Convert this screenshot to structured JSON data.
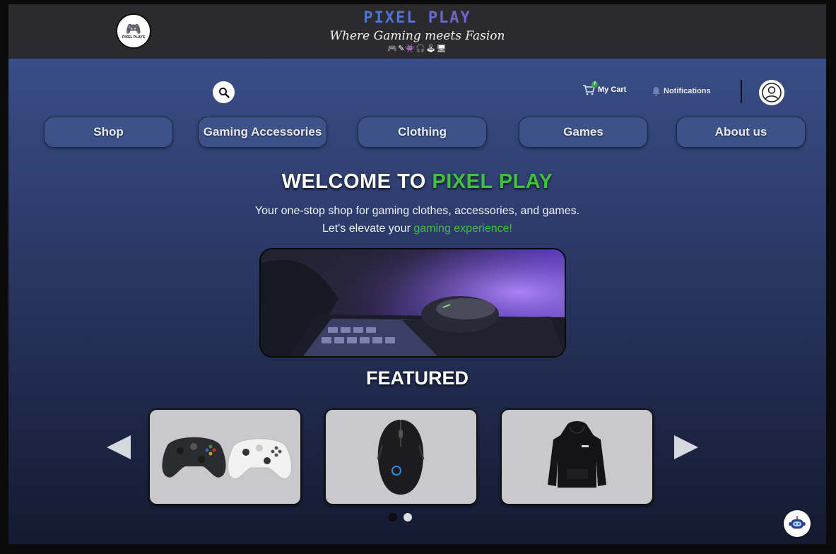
{
  "header": {
    "logo_caption": "PIXEL PLAYS",
    "title": "PIXEL PLAY",
    "tagline": "Where Gaming meets Fasion",
    "icon_strip": "🎮✎👾🎧🕹🖥"
  },
  "toolbar": {
    "cart_label": "My Cart",
    "cart_count": "7",
    "notifications_label": "Notifications"
  },
  "nav": {
    "items": [
      {
        "label": "Shop"
      },
      {
        "label": "Gaming Accessories"
      },
      {
        "label": "Clothing"
      },
      {
        "label": "Games"
      },
      {
        "label": "About us"
      }
    ]
  },
  "hero": {
    "title_prefix": "WELCOME TO ",
    "title_highlight": "PIXEL PLAY",
    "subtitle_line1": "Your one-stop shop for gaming clothes, accessories, and games.",
    "subtitle_line2_prefix": "Let's elevate your ",
    "subtitle_line2_highlight": "gaming experience!"
  },
  "featured": {
    "heading": "FEATURED",
    "items": [
      {
        "product": "xbox-controllers"
      },
      {
        "product": "gaming-mouse"
      },
      {
        "product": "black-hoodie"
      }
    ],
    "pagination": {
      "pages": 2,
      "active": 1
    }
  },
  "colors": {
    "accent_green": "#3fc23c",
    "topbar": "#2b2a2c",
    "nav_button": "#4a5f97"
  }
}
